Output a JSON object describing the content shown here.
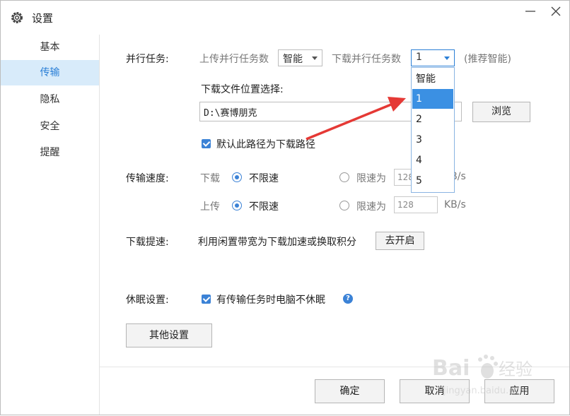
{
  "window": {
    "title": "设置",
    "min_icon": "minimize-icon",
    "close_icon": "close-icon"
  },
  "sidebar": {
    "items": [
      {
        "label": "基本",
        "active": false
      },
      {
        "label": "传输",
        "active": true
      },
      {
        "label": "隐私",
        "active": false
      },
      {
        "label": "安全",
        "active": false
      },
      {
        "label": "提醒",
        "active": false
      }
    ]
  },
  "parallel": {
    "label": "并行任务:",
    "upload_label": "上传并行任务数",
    "upload_value": "智能",
    "download_label": "下载并行任务数",
    "download_value": "1",
    "hint": "(推荐智能)",
    "dropdown_options": [
      "智能",
      "1",
      "2",
      "3",
      "4",
      "5"
    ],
    "dropdown_highlight": "1"
  },
  "location": {
    "label": "下载文件位置选择:",
    "path": "D:\\赛博朋克",
    "browse": "浏览",
    "default_checkbox": "默认此路径为下载路径"
  },
  "speed": {
    "label": "传输速度:",
    "download": {
      "label": "下载",
      "unlimited": "不限速",
      "limit": "限速为",
      "value": "128",
      "unit": "KB/s"
    },
    "upload": {
      "label": "上传",
      "unlimited": "不限速",
      "limit": "限速为",
      "value": "128",
      "unit": "KB/s"
    }
  },
  "boost": {
    "label": "下载提速:",
    "desc": "利用闲置带宽为下载加速或换取积分",
    "button": "去开启"
  },
  "sleep": {
    "label": "休眠设置:",
    "checkbox": "有传输任务时电脑不休眠",
    "help": "?"
  },
  "other_button": "其他设置",
  "footer": {
    "ok": "确定",
    "cancel": "取消",
    "apply": "应用"
  },
  "accent_color": "#3b82d6",
  "arrow_color": "#e53935"
}
